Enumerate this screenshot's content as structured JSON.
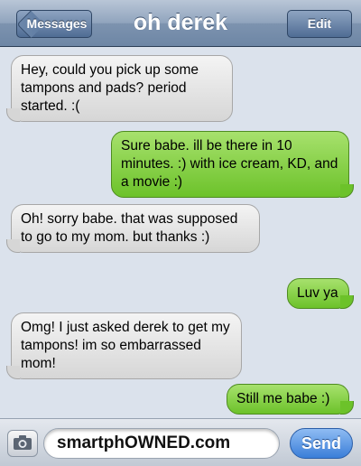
{
  "header": {
    "back_label": "Messages",
    "title": "oh derek",
    "edit_label": "Edit"
  },
  "messages": [
    {
      "from": "them",
      "text": "Hey, could you pick up some tampons and pads? period started. :("
    },
    {
      "from": "me",
      "text": "Sure babe. ill be there in 10 minutes. :) with ice cream, KD, and a movie :)"
    },
    {
      "from": "them",
      "text": "Oh! sorry babe. that was supposed to go to my mom. but thanks :)"
    },
    {
      "from": "me",
      "text": "Luv ya"
    },
    {
      "from": "them",
      "text": "Omg! I just asked derek to get my tampons! im so embarrassed mom!"
    },
    {
      "from": "me",
      "text": "Still me babe :)"
    }
  ],
  "composer": {
    "input_value": "smartphOWNED.com",
    "send_label": "Send",
    "camera_icon": "camera-icon"
  },
  "colors": {
    "incoming_bubble": "#e3e3e3",
    "outgoing_bubble": "#7ccc3a",
    "send_button": "#3a7ed8",
    "nav_bar": "#7d93af"
  }
}
